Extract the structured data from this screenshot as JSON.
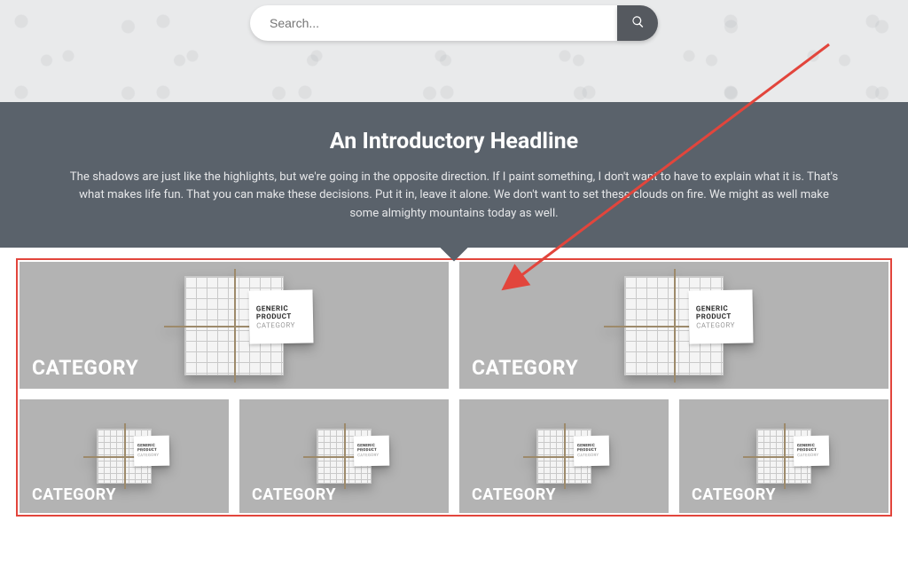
{
  "search": {
    "placeholder": "Search..."
  },
  "intro": {
    "headline": "An Introductory Headline",
    "body": "The shadows are just like the highlights, but we're going in the opposite direction. If I paint something, I don't want to have to explain what it is. That's what makes life fun. That you can make these decisions. Put it in, leave it alone. We don't want to set these clouds on fire. We might as well make some almighty mountains today as well."
  },
  "product_tag": {
    "line1": "GENERIC",
    "line2": "PRODUCT",
    "line3": "CATEGORY"
  },
  "categories": {
    "row1": [
      {
        "label": "CATEGORY"
      },
      {
        "label": "CATEGORY"
      }
    ],
    "row2": [
      {
        "label": "CATEGORY"
      },
      {
        "label": "CATEGORY"
      },
      {
        "label": "CATEGORY"
      },
      {
        "label": "CATEGORY"
      }
    ]
  },
  "annotation": {
    "type": "arrow",
    "color": "#e2453c"
  }
}
